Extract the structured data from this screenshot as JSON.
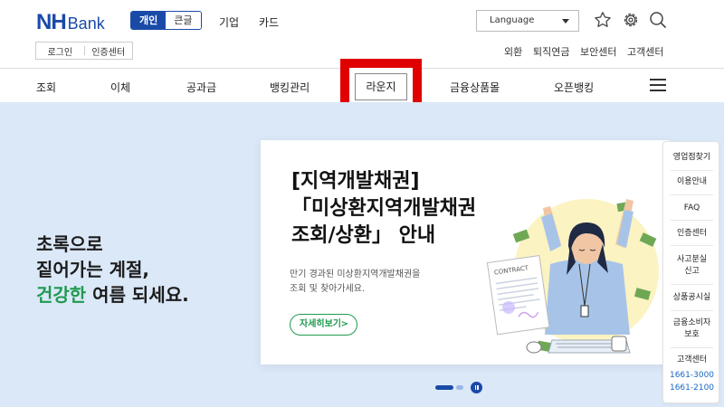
{
  "header": {
    "logo_nh": "NH",
    "logo_bank": "Bank",
    "segment": [
      "개인",
      "큰글"
    ],
    "top_nav": [
      "기업",
      "카드"
    ],
    "language_label": "Language",
    "login": "로그인",
    "auth_center": "인증센터",
    "utility_links": [
      "외환",
      "퇴직연금",
      "보안센터",
      "고객센터"
    ]
  },
  "main_nav": [
    "조회",
    "이체",
    "공과금",
    "뱅킹관리",
    "라운지",
    "금융상품몰",
    "오픈뱅킹"
  ],
  "hero": {
    "slogan_line1": "초록으로",
    "slogan_line2": "짙어가는 계절,",
    "slogan_green": "건강한",
    "slogan_line3_rest": " 여름 되세요.",
    "card_title_lines": [
      "[지역개발채권]",
      "「미상환지역개발채권",
      "조회/상환」 안내"
    ],
    "card_desc_lines": [
      "만기 경과된 미상환지역개발채권을",
      "조회 및 찾아가세요."
    ],
    "more_button": "자세히보기",
    "more_arrow": ">",
    "contract_label": "CONTRACT"
  },
  "quick_menu": {
    "items": [
      "영업점찾기",
      "이용안내",
      "FAQ",
      "인증센터",
      "사고분실",
      "신고",
      "상품공시실",
      "금융소비자",
      "보호",
      "고객센터"
    ],
    "phones": [
      "1661-3000",
      "1661-2100"
    ]
  },
  "colors": {
    "brand_blue": "#1a4aa8",
    "accent_green": "#1f9a4e",
    "highlight_red": "#e00000",
    "hero_bg": "#dbe8f8"
  }
}
